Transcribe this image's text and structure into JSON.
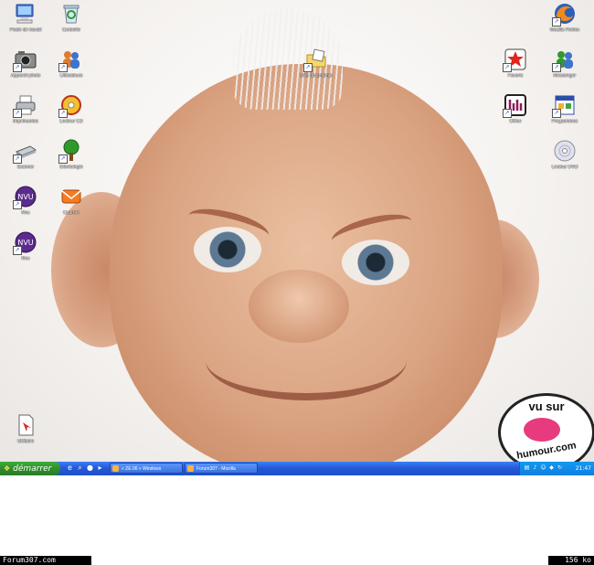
{
  "desktop": {
    "icons_left": [
      {
        "label": "Poste de travail",
        "icon": "computer-icon",
        "shortcut": false
      },
      {
        "label": "Corbeille",
        "icon": "recycle-bin-icon",
        "shortcut": false
      },
      {
        "label": "Appareil photo",
        "icon": "camera-icon",
        "shortcut": true
      },
      {
        "label": "Utilisateurs",
        "icon": "users-icon",
        "shortcut": true
      },
      {
        "label": "Imprimantes",
        "icon": "printer-icon",
        "shortcut": true
      },
      {
        "label": "Lecteur CD",
        "icon": "cd-icon",
        "shortcut": true
      },
      {
        "label": "Scanner",
        "icon": "scanner-icon",
        "shortcut": true
      },
      {
        "label": "Généalogie",
        "icon": "tree-icon",
        "shortcut": true
      },
      {
        "label": "Nvu",
        "icon": "nvu-icon",
        "shortcut": true
      },
      {
        "label": "Courrier",
        "icon": "mail-icon",
        "shortcut": false
      },
      {
        "label": "Nvu",
        "icon": "nvu-icon",
        "shortcut": true
      }
    ],
    "icon_center": {
      "label": "Mes documents",
      "icon": "folder-icon",
      "shortcut": true
    },
    "icons_right": [
      {
        "label": "Mozilla Firefox",
        "icon": "firefox-icon",
        "shortcut": true
      },
      {
        "label": "Favoris",
        "icon": "star-icon",
        "shortcut": true
      },
      {
        "label": "Messenger",
        "icon": "messenger-icon",
        "shortcut": true
      },
      {
        "label": "Office",
        "icon": "office-icon",
        "shortcut": true
      },
      {
        "label": "Programmes",
        "icon": "window-icon",
        "shortcut": true
      },
      {
        "label": "Lecteur DVD",
        "icon": "dvd-icon",
        "shortcut": false
      }
    ],
    "icon_bottom_left": {
      "label": "Utilitaire",
      "icon": "document-icon",
      "shortcut": false
    },
    "stamp": {
      "top_text": "vu sur",
      "bottom_text": "humour.com"
    }
  },
  "taskbar": {
    "start_label": "démarrer",
    "quick_launch": [
      "ie-icon",
      "search-icon",
      "firefox-icon",
      "media-icon"
    ],
    "tasks": [
      {
        "label": "« ZE.06 » Windows"
      },
      {
        "label": "Forum307 - Mozilla"
      }
    ],
    "tray_icons": [
      "network-icon",
      "volume-icon",
      "messenger-icon",
      "shield-icon",
      "update-icon"
    ],
    "clock": "21:47"
  },
  "footer": {
    "site": "Forum307.com",
    "size": "156 ko"
  },
  "colors": {
    "taskbar_blue": "#2457d6",
    "start_green": "#2e8b2b",
    "tray_blue": "#1399f0"
  }
}
